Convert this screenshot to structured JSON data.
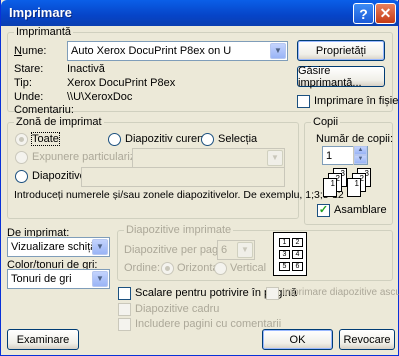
{
  "window": {
    "title": "Imprimare",
    "help": "?",
    "close": "✕"
  },
  "printer": {
    "group_label": "Imprimantă",
    "name_label": "Nume:",
    "name_value": "Auto Xerox DocuPrint P8ex on U",
    "status_label": "Stare:",
    "status_value": "Inactivă",
    "type_label": "Tip:",
    "type_value": "Xerox DocuPrint P8ex",
    "where_label": "Unde:",
    "where_value": "\\\\U\\XeroxDoc",
    "comment_label": "Comentariu:",
    "properties_btn": "Proprietăți",
    "find_btn": "Găsire imprimantă...",
    "print_to_file": "Imprimare în fișier"
  },
  "range": {
    "group_label": "Zonă de imprimat",
    "all": "Toate",
    "current_slide": "Diapozitiv curent",
    "selection": "Selecția",
    "custom_show": "Expunere particularizată:",
    "slides": "Diapozitive:",
    "hint": "Introduceți numerele și/sau zonele diapozitivelor. De exemplu, 1;3;5-12"
  },
  "copies": {
    "group_label": "Copii",
    "count_label": "Număr de copii:",
    "count_value": "1",
    "collate": "Asamblare",
    "collate_checked": true,
    "pages": [
      "1",
      "2",
      "3",
      "1",
      "2",
      "3"
    ]
  },
  "options": {
    "print_what_label": "De imprimat:",
    "print_what_value": "Vizualizare schiță",
    "color_label": "Color/tonuri de gri:",
    "color_value": "Tonuri de gri",
    "handouts_group": "Diapozitive imprimate",
    "per_page_label": "Diapozitive per pagină:",
    "per_page_value": "6",
    "order_label": "Ordine:",
    "horizontal": "Orizontal",
    "vertical": "Vertical",
    "layout_cells": [
      "1",
      "2",
      "3",
      "4",
      "5",
      "6"
    ],
    "scale_to_fit": "Scalare pentru potrivire în pagină",
    "frame_slides": "Diapozitive cadru",
    "include_comments": "Includere pagini cu comentarii",
    "print_hidden": "Imprimare diapozitive ascunse"
  },
  "footer": {
    "preview": "Examinare",
    "ok": "OK",
    "cancel": "Revocare"
  }
}
